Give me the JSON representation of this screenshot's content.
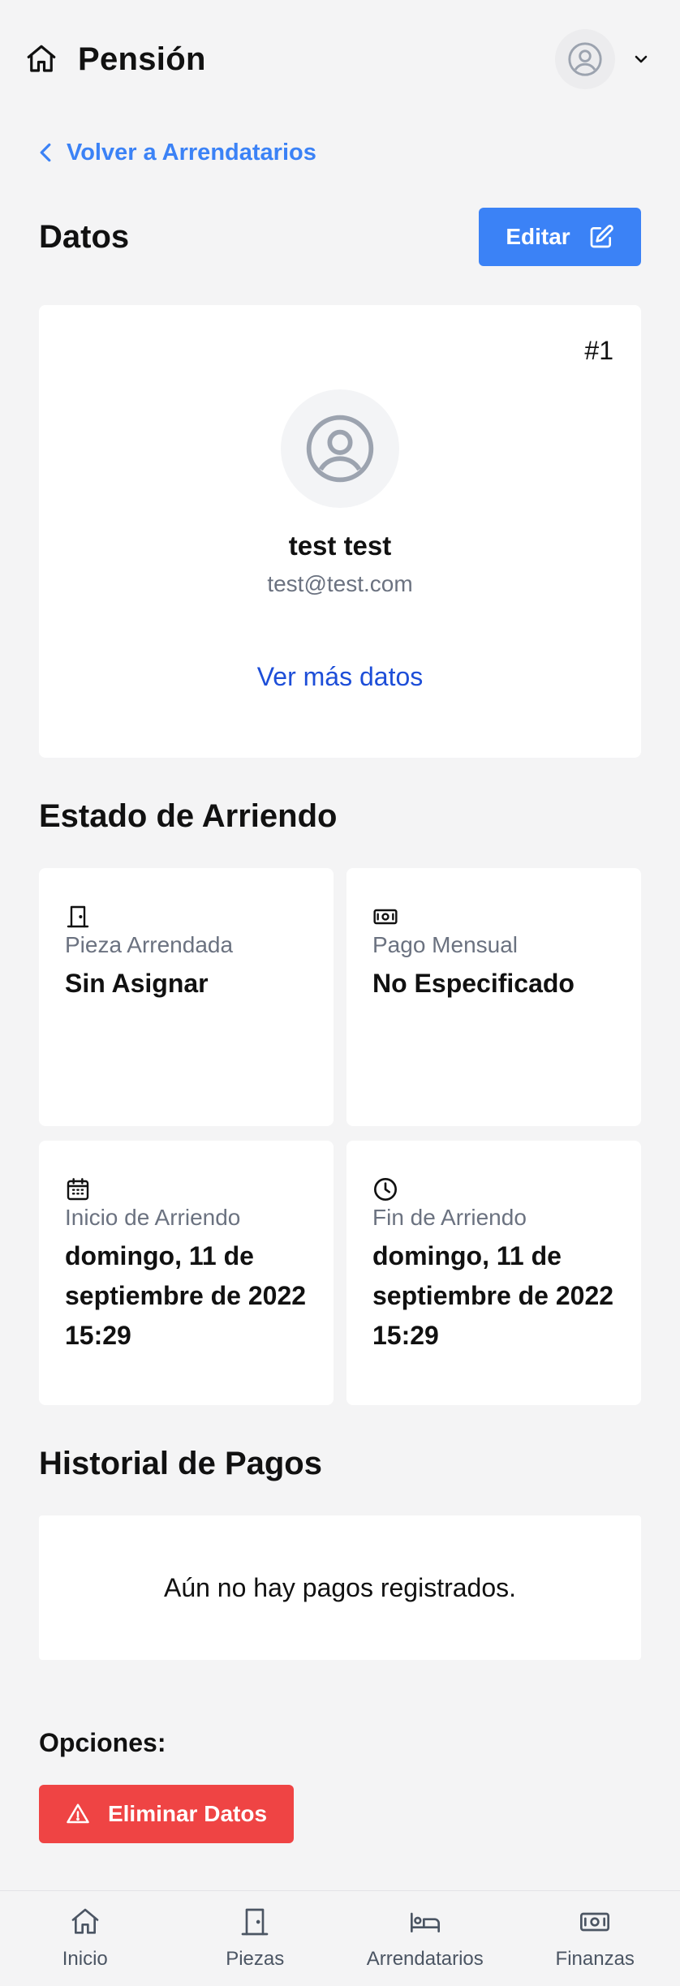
{
  "header": {
    "title": "Pensión"
  },
  "back_link": {
    "label": "Volver a Arrendatarios"
  },
  "datos": {
    "title": "Datos",
    "edit_label": "Editar"
  },
  "profile": {
    "number": "#1",
    "name": "test test",
    "email": "test@test.com",
    "more_link": "Ver más datos"
  },
  "estado": {
    "title": "Estado de Arriendo",
    "tiles": [
      {
        "icon": "door-icon",
        "label": "Pieza Arrendada",
        "value": "Sin Asignar"
      },
      {
        "icon": "cash-icon",
        "label": "Pago Mensual",
        "value": "No Especificado"
      },
      {
        "icon": "calendar-icon",
        "label": "Inicio de Arriendo",
        "value": "domingo, 11 de septiembre de 2022 15:29"
      },
      {
        "icon": "clock-icon",
        "label": "Fin de Arriendo",
        "value": "domingo, 11 de septiembre de 2022 15:29"
      }
    ]
  },
  "historial": {
    "title": "Historial de Pagos",
    "empty_text": "Aún no hay pagos registrados."
  },
  "opciones": {
    "title": "Opciones:",
    "delete_label": "Eliminar Datos"
  },
  "nav": {
    "items": [
      {
        "icon": "home-icon",
        "label": "Inicio"
      },
      {
        "icon": "door-icon",
        "label": "Piezas"
      },
      {
        "icon": "bed-icon",
        "label": "Arrendatarios"
      },
      {
        "icon": "cash-icon",
        "label": "Finanzas"
      }
    ]
  },
  "colors": {
    "primary": "#3b82f6",
    "link": "#1d4ed8",
    "danger": "#ef4444",
    "background": "#f4f4f5"
  }
}
